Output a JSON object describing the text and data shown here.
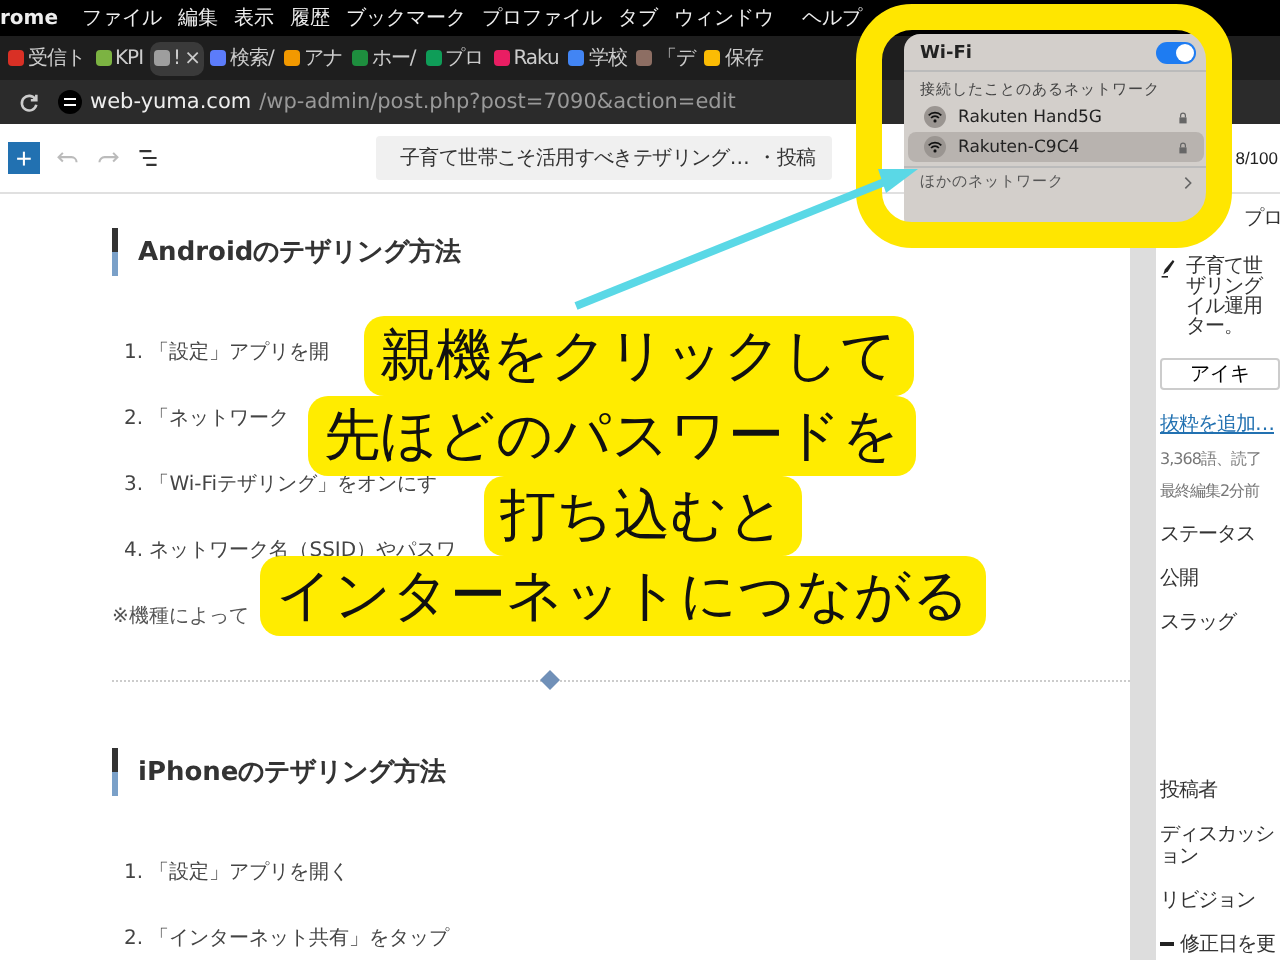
{
  "menu_bar": {
    "items": [
      "rome",
      "ファイル",
      "編集",
      "表示",
      "履歴",
      "ブックマーク",
      "プロファイル",
      "タブ",
      "ウィンドウ"
    ],
    "help": "ヘルプ"
  },
  "tabs": [
    {
      "label": "受信ト",
      "selected": false,
      "color": "#d93025"
    },
    {
      "label": "KPI",
      "selected": false,
      "color": "#7cb342"
    },
    {
      "label": "!",
      "selected": true,
      "color": "#9e9e9e"
    },
    {
      "label": "検索/",
      "selected": false,
      "color": "#5c7cfa"
    },
    {
      "label": "アナ",
      "selected": false,
      "color": "#f29900"
    },
    {
      "label": "ホー/",
      "selected": false,
      "color": "#1e8e3e"
    },
    {
      "label": "プロ",
      "selected": false,
      "color": "#0f9d58"
    },
    {
      "label": "Raku",
      "selected": false,
      "color": "#e91e63"
    },
    {
      "label": "学校",
      "selected": false,
      "color": "#4285f4"
    },
    {
      "label": "「デ",
      "selected": false,
      "color": "#8d6e63"
    },
    {
      "label": "保存",
      "selected": false,
      "color": "#fbbc04"
    }
  ],
  "tab_close": "×",
  "address_bar": {
    "domain": "web-yuma.com",
    "path": "/wp-admin/post.php?post=7090&action=edit"
  },
  "editor_toolbar": {
    "add": "+",
    "document_title": "子育て世帯こそ活用すべきテザリング…",
    "post_type": "・投稿",
    "counter": "8/100"
  },
  "content": [
    {
      "heading": "Androidのテザリング方法",
      "items": [
        "1. 「設定」アプリを開",
        "2. 「ネットワーク",
        "3. 「Wi-Fiテザリング」をオンにす",
        "4. ネットワーク名（SSID）やパスワ"
      ],
      "note": "※機種によって"
    },
    {
      "heading": "iPhoneのテザリング方法",
      "items": [
        "1. 「設定」アプリを開く",
        "2. 「インターネット共有」をタップ"
      ]
    }
  ],
  "sidebar": {
    "tab": "プロ",
    "excerpt": [
      "子育て世",
      "ザリング",
      "イル運用",
      "ター。"
    ],
    "button": "アイキ",
    "link": "抜粋を追加…",
    "meta": [
      "3,368語、読了",
      "最終編集2分前"
    ],
    "fields": [
      "ステータス",
      "公開",
      "スラッグ",
      "投稿者",
      "ディスカッション",
      "リビジョン"
    ],
    "checkbox": {
      "label": "修正日を更",
      "checked": false
    }
  },
  "wifi_menu": {
    "title": "Wi-Fi",
    "on": true,
    "section": "接続したことのあるネットワーク",
    "networks": [
      {
        "name": "Rakuten Hand5G",
        "selected": false
      },
      {
        "name": "Rakuten-C9C4",
        "selected": true
      }
    ],
    "other": "ほかのネットワーク"
  },
  "callout": {
    "lines": [
      "親機をクリックして",
      "先ほどのパスワードを",
      "打ち込むと",
      "インターネットにつながる"
    ]
  }
}
